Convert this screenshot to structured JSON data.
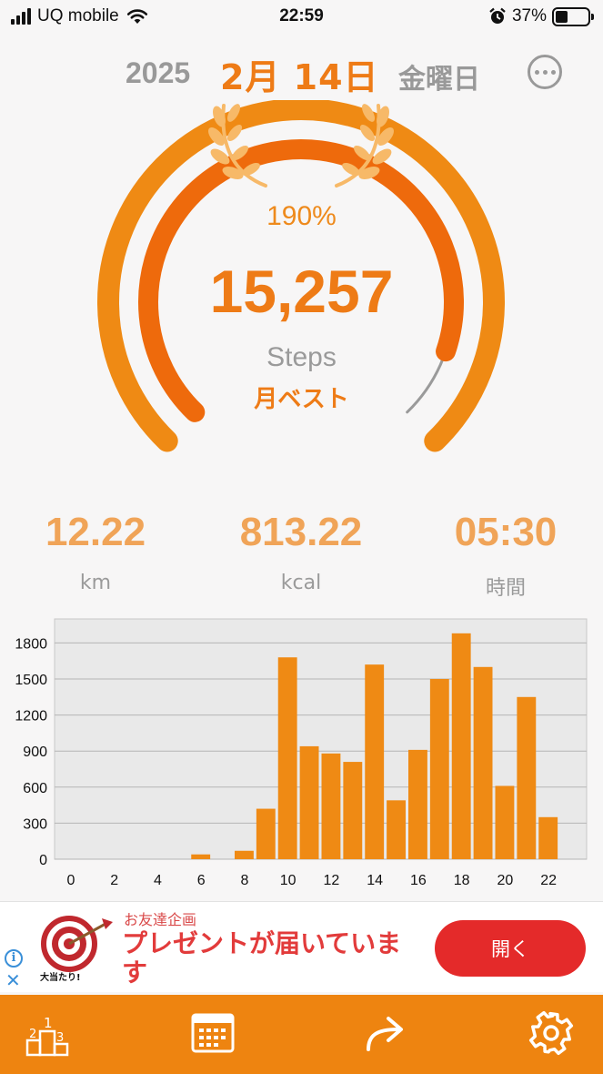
{
  "status_bar": {
    "carrier": "UQ mobile",
    "time": "22:59",
    "battery_percent": "37%",
    "battery_level": 0.37,
    "icons": [
      "signal-icon",
      "wifi-icon",
      "alarm-icon",
      "battery-icon"
    ]
  },
  "header": {
    "year": "2025",
    "month_day": "2月 14日",
    "weekday": "金曜日",
    "more_icon": "more-icon"
  },
  "gauge": {
    "percent": "190%",
    "steps": "15,257",
    "steps_label": "Steps",
    "badge": "月ベスト",
    "progress_ratio": 1.9,
    "colors": {
      "outer": "#ef8a14",
      "inner": "#ee6a0c",
      "overflow": "#9a9a9a",
      "laurel": "#f7b968"
    }
  },
  "stats": [
    {
      "value": "12.22",
      "unit": "km"
    },
    {
      "value": "813.22",
      "unit": "kcal"
    },
    {
      "value": "05:30",
      "unit": "時間"
    }
  ],
  "chart_data": {
    "type": "bar",
    "categories": [
      0,
      1,
      2,
      3,
      4,
      5,
      6,
      7,
      8,
      9,
      10,
      11,
      12,
      13,
      14,
      15,
      16,
      17,
      18,
      19,
      20,
      21,
      22,
      23
    ],
    "values": [
      0,
      0,
      0,
      0,
      0,
      0,
      40,
      0,
      70,
      420,
      1680,
      940,
      880,
      810,
      1620,
      490,
      910,
      1500,
      1880,
      1600,
      610,
      1350,
      350,
      0
    ],
    "x_ticks": [
      "0",
      "2",
      "4",
      "6",
      "8",
      "10",
      "12",
      "14",
      "16",
      "18",
      "20",
      "22"
    ],
    "y_ticks": [
      "0",
      "300",
      "600",
      "900",
      "1200",
      "1500",
      "1800"
    ],
    "ylim": [
      0,
      2000
    ],
    "grid": true,
    "bar_color": "#ef8a14",
    "plot_bg": "#e9e9e9"
  },
  "ad": {
    "sub": "お友達企画",
    "title": "プレゼントが届いています",
    "button": "開く",
    "stamp_text": "大当たり!",
    "info_icon": "info-icon",
    "close_icon": "close-icon"
  },
  "tabbar": {
    "items": [
      {
        "icon": "ranking-icon",
        "ranks": [
          "2",
          "1",
          "3"
        ]
      },
      {
        "icon": "calendar-icon"
      },
      {
        "icon": "share-icon"
      },
      {
        "icon": "gear-icon"
      }
    ]
  }
}
